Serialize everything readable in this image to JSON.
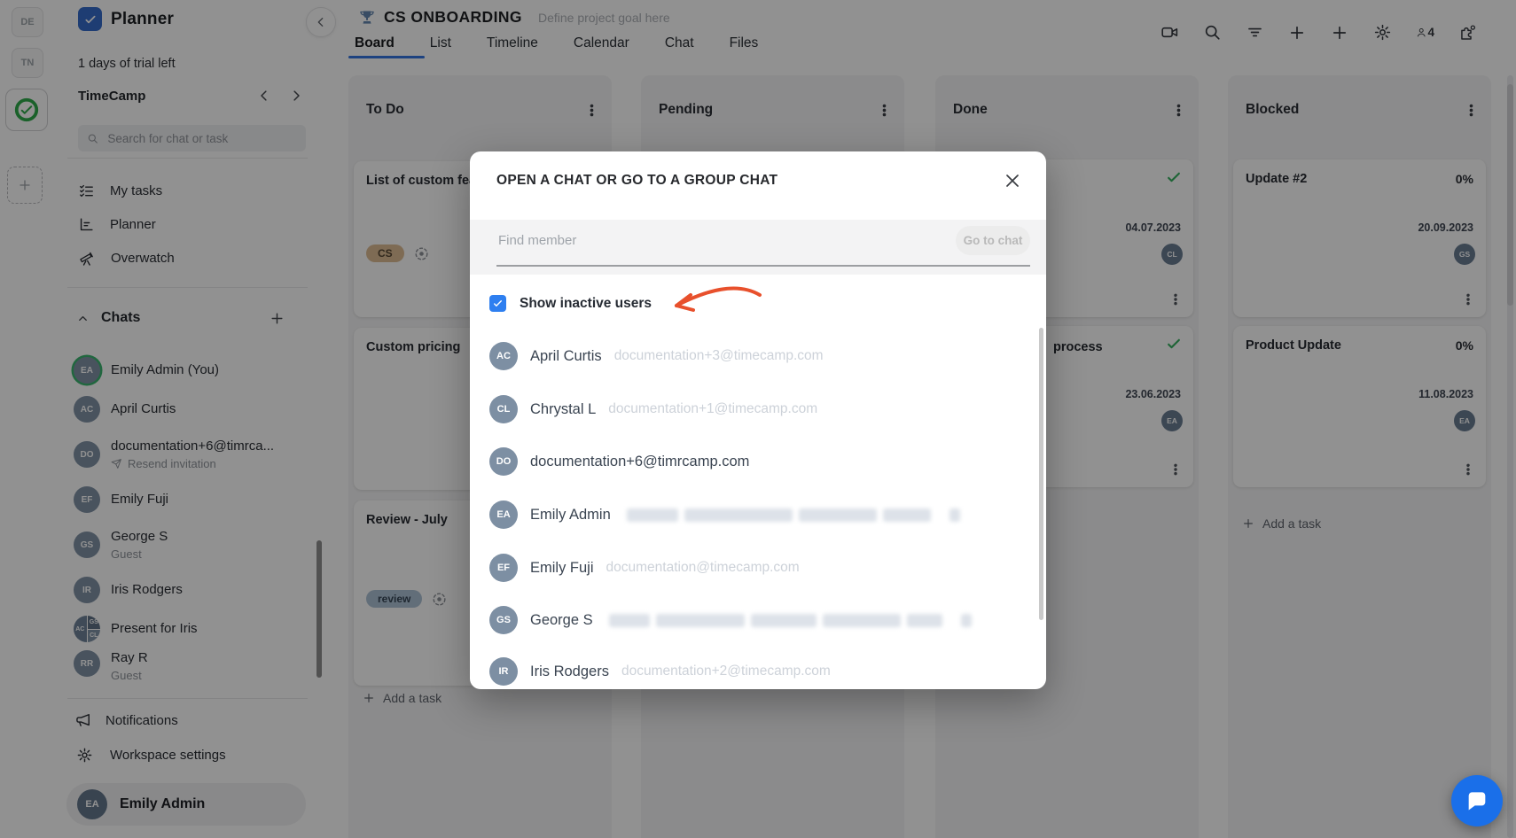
{
  "colors": {
    "accent_blue": "#2d6fe0",
    "checkbox_blue": "#2e7ff0",
    "arrow_orange": "#e8502c",
    "done_green": "#2fae5a",
    "fab_blue": "#1a6fe9",
    "tag_cs": "#dcbb90",
    "tag_review": "#a9bfd4",
    "avatar_slate": "#7d8fa3"
  },
  "rail": {
    "workspaces": [
      "DE",
      "TN"
    ]
  },
  "sidebar": {
    "app_name": "Planner",
    "trial_text": "1 days of trial left",
    "workspace_name": "TimeCamp",
    "search_placeholder": "Search for chat or task",
    "nav": [
      {
        "label": "My tasks"
      },
      {
        "label": "Planner"
      },
      {
        "label": "Overwatch"
      }
    ],
    "chats_label": "Chats",
    "chats": [
      {
        "initials": "EA",
        "name": "Emily Admin (You)"
      },
      {
        "initials": "AC",
        "name": "April Curtis"
      },
      {
        "initials": "DO",
        "name": "documentation+6@timrca...",
        "sub": "Resend invitation"
      },
      {
        "initials": "EF",
        "name": "Emily Fuji"
      },
      {
        "initials": "GS",
        "name": "George S",
        "sub": "Guest"
      },
      {
        "initials": "IR",
        "name": "Iris Rodgers"
      },
      {
        "name": "Present for Iris",
        "group": [
          "AC",
          "GS",
          "CL"
        ]
      },
      {
        "initials": "RR",
        "name": "Ray R",
        "sub": "Guest"
      }
    ],
    "notifications_label": "Notifications",
    "settings_label": "Workspace settings",
    "profile": {
      "initials": "EA",
      "name": "Emily Admin"
    }
  },
  "header": {
    "project_title": "CS ONBOARDING",
    "goal_placeholder": "Define project goal here",
    "tabs": [
      "Board",
      "List",
      "Timeline",
      "Calendar",
      "Chat",
      "Files"
    ],
    "active_tab": "Board",
    "members_count": "4"
  },
  "board": {
    "columns": [
      {
        "title": "To Do"
      },
      {
        "title": "Pending"
      },
      {
        "title": "Done"
      },
      {
        "title": "Blocked"
      }
    ],
    "todo_cards": [
      {
        "title": "List of custom fea",
        "tag": "CS"
      },
      {
        "title": "Custom pricing"
      },
      {
        "title": "Review - July",
        "tag": "review"
      }
    ],
    "done_cards": [
      {
        "date": "04.07.2023",
        "avatar": "CL"
      },
      {
        "title": "process",
        "date": "23.06.2023",
        "avatar": "EA"
      }
    ],
    "blocked_cards": [
      {
        "title": "Update #2",
        "percent": "0%",
        "date": "20.09.2023",
        "avatar": "GS"
      },
      {
        "title": "Product Update",
        "percent": "0%",
        "date": "11.08.2023",
        "avatar": "EA"
      }
    ],
    "add_task_label": "Add a task"
  },
  "modal": {
    "title": "OPEN A CHAT OR GO TO A GROUP CHAT",
    "find_placeholder": "Find member",
    "go_to_chat_label": "Go to chat",
    "show_inactive_label": "Show inactive users",
    "checkbox_checked": true,
    "members": [
      {
        "initials": "AC",
        "name": "April Curtis",
        "email": "documentation+3@timecamp.com"
      },
      {
        "initials": "CL",
        "name": "Chrystal L",
        "email": "documentation+1@timecamp.com"
      },
      {
        "initials": "DO",
        "name": "documentation+6@timrcamp.com",
        "email": ""
      },
      {
        "initials": "EA",
        "name": "Emily Admin",
        "email": "",
        "email_redacted": true
      },
      {
        "initials": "EF",
        "name": "Emily Fuji",
        "email": "documentation@timecamp.com"
      },
      {
        "initials": "GS",
        "name": "George S",
        "email": "",
        "email_redacted": true
      },
      {
        "initials": "IR",
        "name": "Iris Rodgers",
        "email": "documentation+2@timecamp.com"
      }
    ]
  }
}
